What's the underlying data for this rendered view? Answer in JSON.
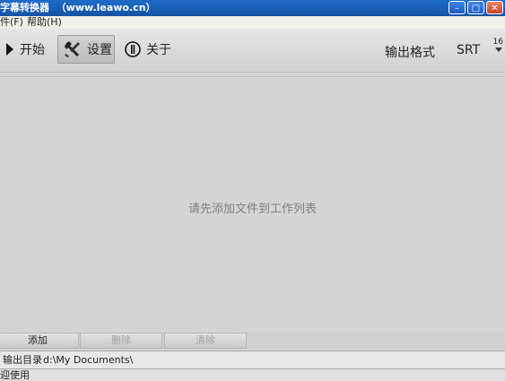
{
  "window": {
    "title": "字幕转换器  （www.leawo.cn）"
  },
  "window_buttons": {
    "minimize": "–",
    "maximize": "□",
    "close": "✕"
  },
  "menu": {
    "items": [
      {
        "label": "件(F)"
      },
      {
        "label": "帮助(H)"
      }
    ]
  },
  "toolbar": {
    "start_label": "开始",
    "settings_label": "设置",
    "about_label": "关于",
    "output_format_label": "输出格式",
    "format_value": "SRT",
    "overflow_number": "16"
  },
  "main": {
    "empty_message": "请先添加文件到工作列表"
  },
  "list_buttons": {
    "add": "添加",
    "delete": "删除",
    "clear": "清除"
  },
  "output": {
    "label": "输出目录",
    "path": "d:\\My Documents\\"
  },
  "status": {
    "text": "迎使用"
  },
  "colors": {
    "titlebar": "#1a5db4",
    "background": "#d4d4d4"
  },
  "icons": {
    "start": "play-icon",
    "settings": "tools-icon",
    "about": "info-icon"
  }
}
